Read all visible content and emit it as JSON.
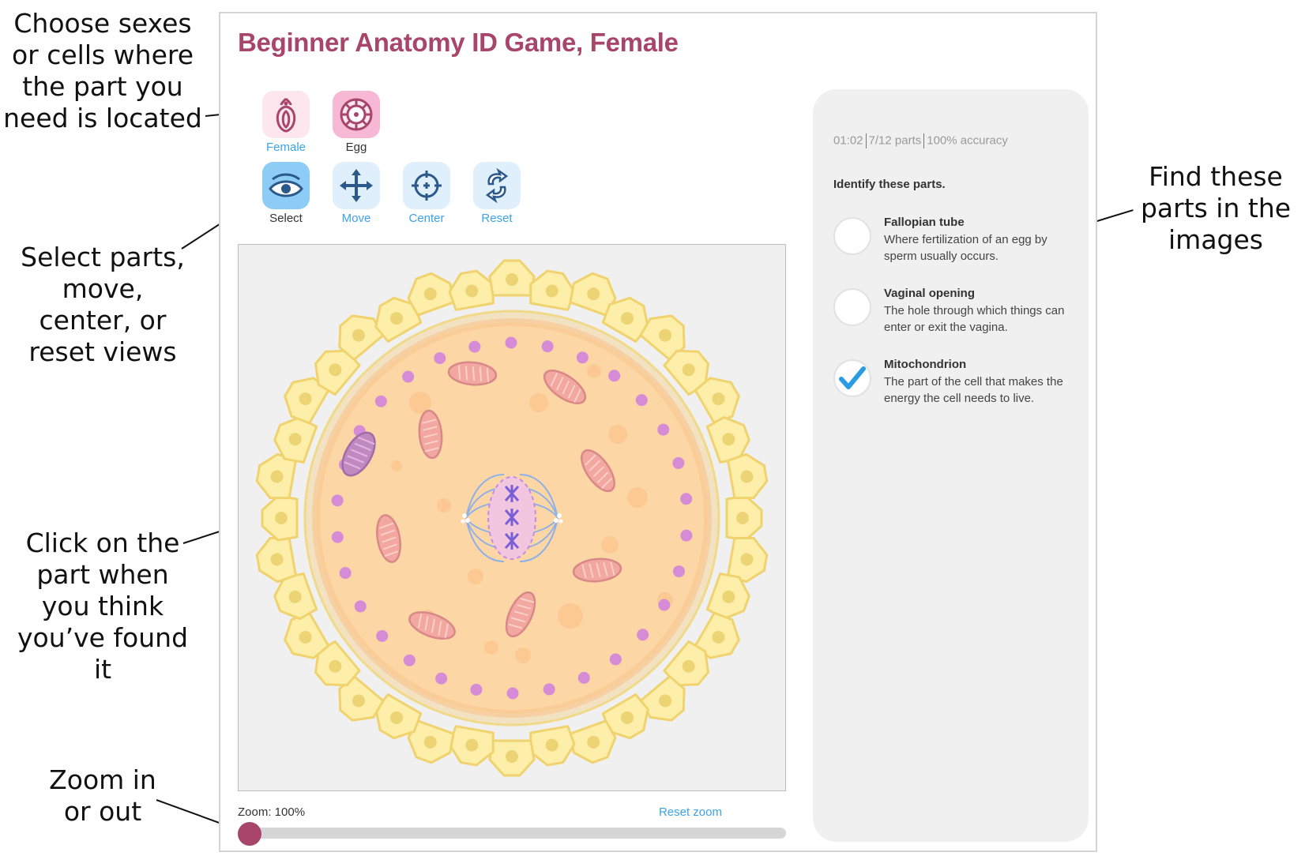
{
  "annotations": [
    {
      "id": "choose",
      "text": "Choose sexes or cells where the part you need is located"
    },
    {
      "id": "select",
      "text": "Select parts, move, center, or reset views"
    },
    {
      "id": "click",
      "text": "Click on the part when you think you’ve found it"
    },
    {
      "id": "zoom",
      "text": "Zoom in or out"
    },
    {
      "id": "find",
      "text": "Find these parts in the images"
    }
  ],
  "annotation_lines": {
    "choose": [
      "Choose sexes",
      "or cells where",
      "the part you",
      "need is located"
    ],
    "select": [
      "Select parts,",
      "move,",
      "center, or",
      "reset views"
    ],
    "click": [
      "Click on the",
      "part when",
      "you think",
      "you’ve found",
      "it"
    ],
    "zoom": [
      "Zoom in",
      "or out"
    ],
    "find": [
      "Find these",
      "parts in the",
      "images"
    ]
  },
  "game": {
    "title": "Beginner Anatomy ID Game, Female",
    "accent_color": "#a8466a",
    "link_color": "#3ba3e8"
  },
  "categories": [
    {
      "label": "Female",
      "icon": "female-anatomy-icon",
      "selected": true
    },
    {
      "label": "Egg",
      "icon": "egg-cell-icon",
      "selected": false
    }
  ],
  "tools": [
    {
      "label": "Select",
      "icon": "eye-icon",
      "active": true
    },
    {
      "label": "Move",
      "icon": "move-arrows-icon",
      "active": false
    },
    {
      "label": "Center",
      "icon": "crosshair-icon",
      "active": false
    },
    {
      "label": "Reset",
      "icon": "reset-arrows-icon",
      "active": false
    }
  ],
  "viewer": {
    "image": "egg cell with corona radiata, mitochondria and spindle",
    "highlighted_part": "mitochondrion"
  },
  "zoom": {
    "label": "Zoom: 100%",
    "value_percent": 100,
    "slider_fraction": 0,
    "reset_label": "Reset zoom"
  },
  "panel": {
    "timer": "01:02",
    "progress": "7/12 parts",
    "accuracy": "100% accuracy",
    "instruction": "Identify these parts.",
    "parts": [
      {
        "name": "Fallopian tube",
        "description": "Where fertilization of an egg by sperm usually occurs.",
        "found": false
      },
      {
        "name": "Vaginal opening",
        "description": "The hole through which things can enter or exit the vagina.",
        "found": false
      },
      {
        "name": "Mitochondrion",
        "description": "The part of the cell that makes the energy the cell needs to live.",
        "found": true
      }
    ]
  }
}
